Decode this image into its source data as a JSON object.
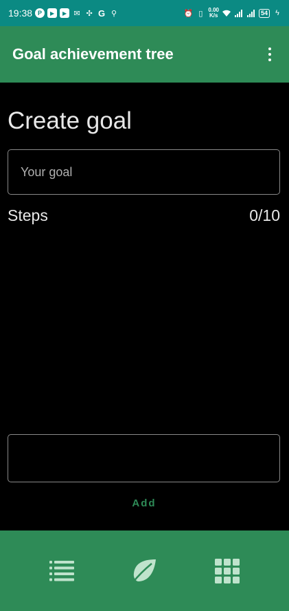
{
  "status_bar": {
    "time": "19:38",
    "net_speed_value": "0.00",
    "net_speed_unit": "K/s",
    "battery": "54"
  },
  "app_bar": {
    "title": "Goal achievement tree",
    "menu_icon": "more-vert-icon"
  },
  "main": {
    "heading": "Create goal",
    "goal_input": {
      "placeholder": "Your goal",
      "value": ""
    },
    "steps_label": "Steps",
    "steps_count": "0/10",
    "step_input": {
      "placeholder": "",
      "value": ""
    },
    "add_label": "Add"
  },
  "bottom_nav": {
    "items": [
      {
        "icon": "list-icon"
      },
      {
        "icon": "leaf-icon"
      },
      {
        "icon": "grid-icon"
      }
    ]
  },
  "colors": {
    "status_bar": "#0b8a83",
    "primary": "#2e8b57",
    "background": "#000000"
  }
}
